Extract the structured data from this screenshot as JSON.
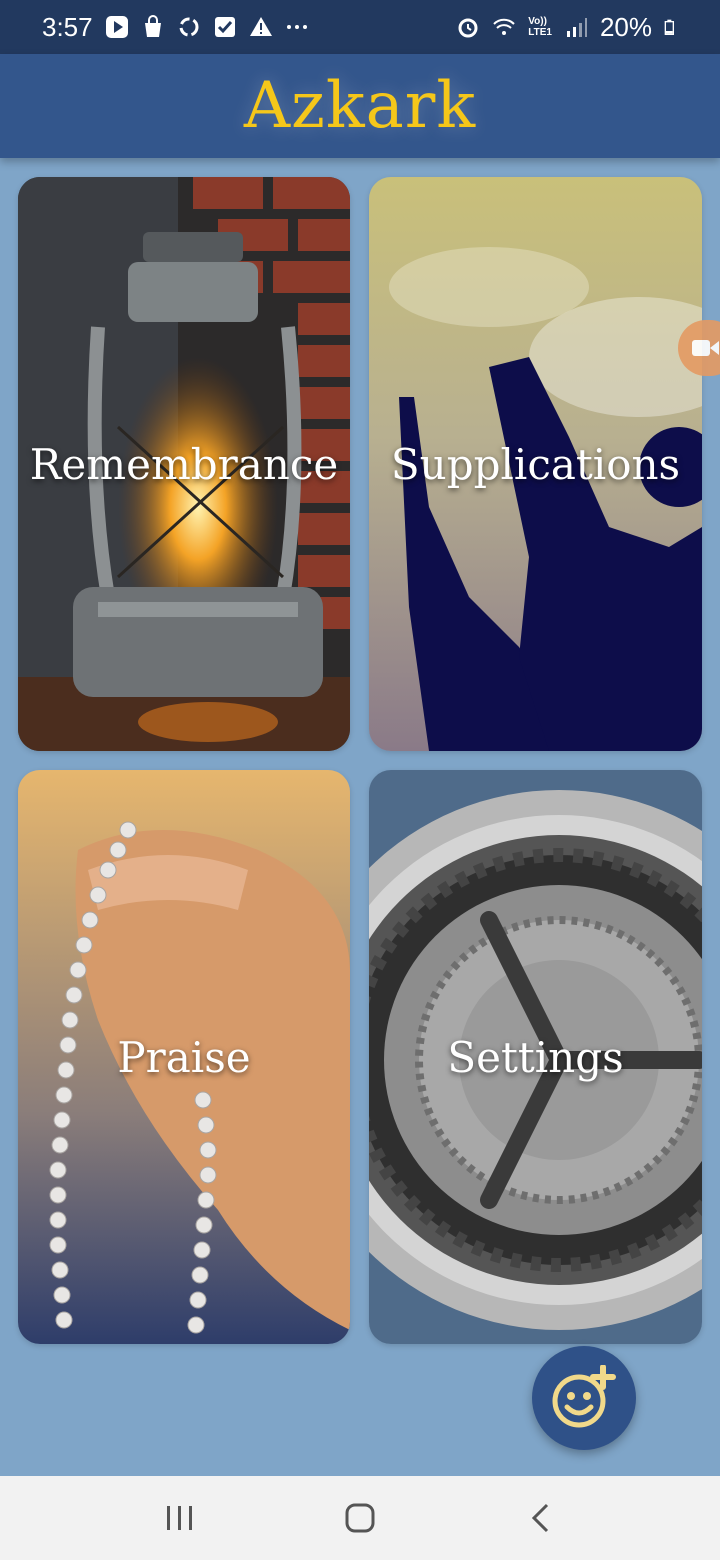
{
  "status_bar": {
    "time": "3:57",
    "battery": "20%",
    "left_icons": [
      "play-icon",
      "bag-icon",
      "sync-icon",
      "check-icon",
      "warning-icon",
      "more-icon"
    ],
    "right_icons": [
      "alarm-icon",
      "wifi-icon",
      "volte-icon",
      "signal-icon",
      "battery-icon"
    ],
    "network_label_1": "Vo))",
    "network_label_2": "LTE1"
  },
  "app_bar": {
    "title": "Azkark",
    "title_color": "#f5c71a",
    "background": "#33568c"
  },
  "cards": [
    {
      "label": "Remembrance",
      "image": "lantern-image"
    },
    {
      "label": "Supplications",
      "image": "praying-hands-image"
    },
    {
      "label": "Praise",
      "image": "prayer-beads-image"
    },
    {
      "label": "Settings",
      "image": "gear-image"
    }
  ],
  "fab": {
    "icon": "add-emoji-icon",
    "background": "#2f5188"
  },
  "side_tab": {
    "icon": "video-icon",
    "color": "#e49a63"
  },
  "nav_bar": {
    "buttons": [
      "recent-apps-icon",
      "home-icon",
      "back-icon"
    ]
  },
  "colors": {
    "page_background": "#7fa5c8",
    "status_bar": "#22395f"
  }
}
